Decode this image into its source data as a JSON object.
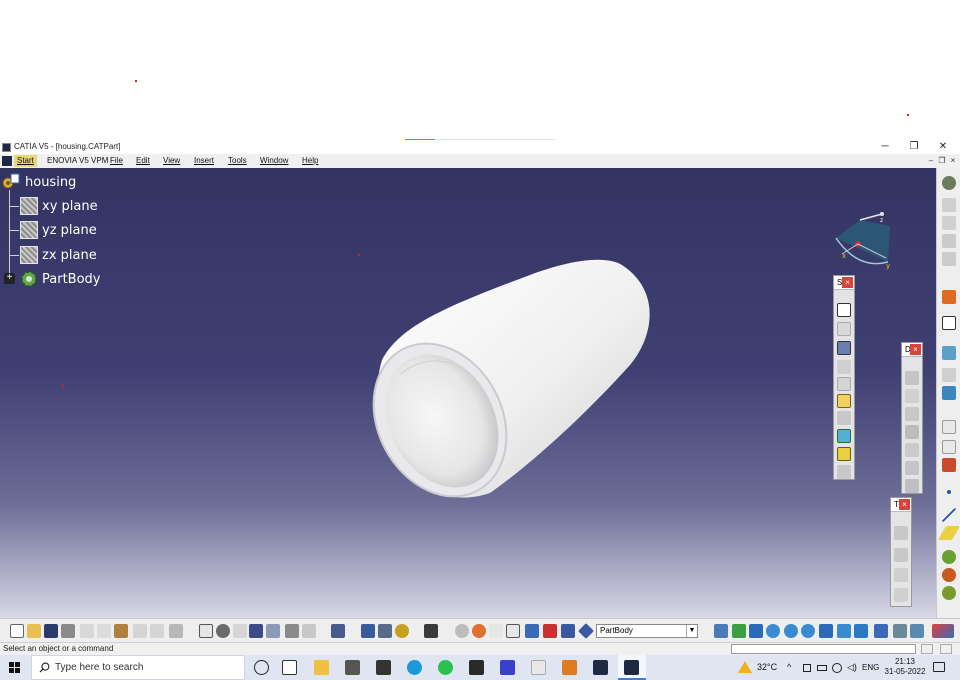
{
  "window": {
    "title": "CATIA V5 - [housing.CATPart]",
    "controls": [
      "─",
      "❐",
      "✕"
    ]
  },
  "menubar": {
    "items": [
      "Start",
      "ENOVIA V5 VPM",
      "File",
      "Edit",
      "View",
      "Insert",
      "Tools",
      "Window",
      "Help"
    ],
    "mdi_controls": [
      "–",
      "❐",
      "×"
    ]
  },
  "tree": {
    "root": "housing",
    "children": [
      "xy plane",
      "yz plane",
      "zx plane",
      "PartBody"
    ],
    "expander": "+"
  },
  "compass": {
    "axes": [
      "x",
      "y",
      "z"
    ]
  },
  "floating_toolbars": [
    {
      "name": "S",
      "close": "×",
      "icons": [
        "sketch-icon",
        "positioned-sketch-icon",
        "profile-icon",
        "pad-icon",
        "pocket-icon",
        "edit-icon",
        "shaft-icon",
        "cube-icon",
        "groove-icon",
        "hole-icon"
      ]
    },
    {
      "name": "D",
      "close": "×",
      "icons": [
        "fillet-icon",
        "chamfer-icon",
        "draft-icon",
        "shell-icon",
        "thickness-icon",
        "thread-icon",
        "remove-face-icon",
        "replace-face-icon"
      ]
    },
    {
      "name": "T",
      "close": "×",
      "icons": [
        "translate-icon",
        "mirror-icon",
        "pattern-icon",
        "scale-icon"
      ]
    }
  ],
  "right_toolbar": {
    "icons": [
      "gear-icon",
      "sketch-based-icon",
      "dress-up-icon",
      "surface-icon",
      "select-arrow-icon",
      "sketcher-icon",
      "layers-icon",
      "datum-icon",
      "frame-icon",
      "text-annotation-icon",
      "constraint-icon",
      "render-icon",
      "point-icon",
      "line-icon",
      "plane-icon",
      "measure-icon",
      "apply-material-icon",
      "analysis-icon"
    ]
  },
  "bottom_toolbar": {
    "body_selector": "PartBody",
    "icons": [
      "new-icon",
      "open-icon",
      "save-icon",
      "print-icon",
      "cut-icon",
      "copy-icon",
      "paste-icon",
      "undo-icon",
      "redo-icon",
      "whats-this-icon",
      "formula-icon",
      "knowledge-icon",
      "design-table-icon",
      "law-icon",
      "catalog-icon",
      "parameter-icon",
      "update-icon",
      "hide-icon",
      "swap-icon",
      "axis-system-icon",
      "scan-icon",
      "fly-icon",
      "compass-icon",
      "selector-icon",
      "fit-all-icon",
      "pan-icon",
      "rotate-icon",
      "zoom-in-icon",
      "zoom-out-icon",
      "normal-view-icon",
      "iso-view-icon",
      "views-icon",
      "shading-icon",
      "hide-show-icon",
      "swap-visible-icon",
      "catia-logo-icon"
    ]
  },
  "status": {
    "message": "Select an object or a command"
  },
  "taskbar": {
    "search_placeholder": "Type here to search",
    "temperature": "32°C",
    "language": "ENG",
    "time": "21:13",
    "date": "31-05-2022"
  },
  "colors": {
    "viewport_top": "#343463",
    "viewport_bottom": "#d8d8e6",
    "model_surface": "#f2f2f2",
    "close_button": "#d9443a",
    "tree_text": "#ffffff"
  }
}
